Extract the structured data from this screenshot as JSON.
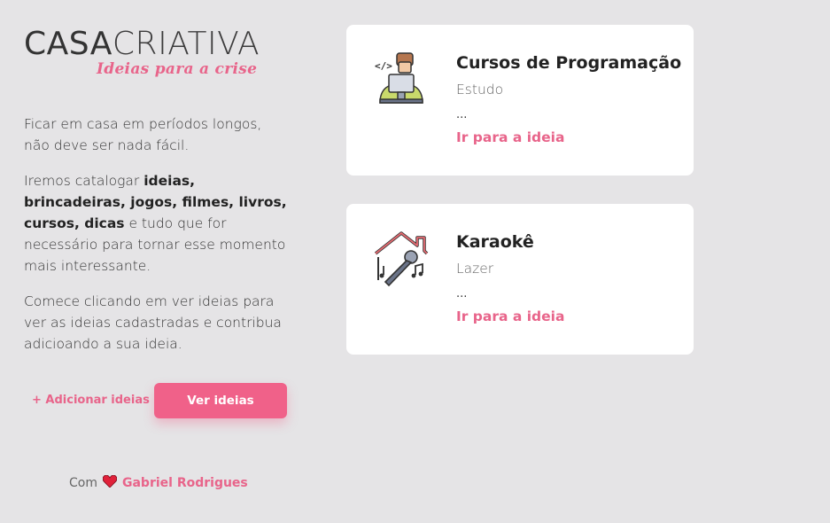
{
  "logo": {
    "main_bold": "CASA",
    "main_light": "CRIATIVA",
    "tagline": "Ideias para a crise"
  },
  "description": {
    "p1": "Ficar em casa em períodos longos, não deve ser nada fácil.",
    "p2_intro": "Iremos catalogar ",
    "p2_bold1": "ideias, brincadeiras, jogos, filmes, livros, cursos, dicas",
    "p2_outro": " e tudo que for necessário para tornar esse momento mais interessante.",
    "p3": "Comece clicando em ver ideias para ver as ideias cadastradas e contribua adicioando a sua ideia."
  },
  "actions": {
    "add_label": "+ Adicionar ideias",
    "see_label": "Ver ideias"
  },
  "footer": {
    "prefix": "Com",
    "heart_icon": "heart-icon",
    "author": "Gabriel Rodrigues"
  },
  "cards": [
    {
      "title": "Cursos de Programação",
      "category": "Estudo",
      "more": "...",
      "link": "Ir para a ideia",
      "icon": "programmer-icon"
    },
    {
      "title": "Karaokê",
      "category": "Lazer",
      "more": "...",
      "link": "Ir para a ideia",
      "icon": "karaoke-icon"
    }
  ],
  "colors": {
    "accent": "#f06189",
    "background": "#e5e4e6",
    "card": "#ffffff"
  }
}
